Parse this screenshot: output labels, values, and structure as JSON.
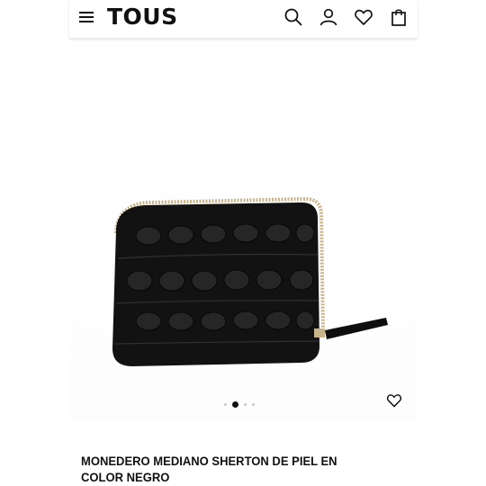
{
  "header": {
    "logo": "TOUS",
    "icons": [
      "menu-icon",
      "search-icon",
      "account-icon",
      "heart-icon",
      "shopping-bag-icon"
    ]
  },
  "gallery": {
    "image_count": 4,
    "active_index": 1
  },
  "product": {
    "title": "MONEDERO MEDIANO SHERTON DE PIEL EN COLOR NEGRO"
  },
  "colors": {
    "text": "#111111",
    "wallet": "#121212",
    "zipper": "#c9b48a",
    "dot_inactive": "#c7c7c7"
  }
}
